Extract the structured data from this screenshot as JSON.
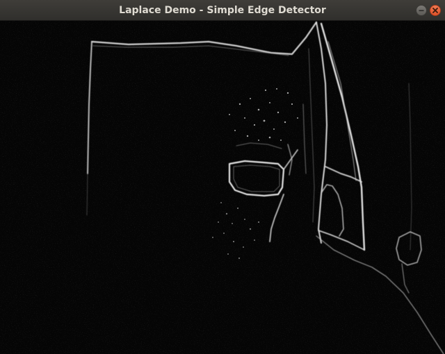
{
  "window": {
    "title": "Laplace Demo - Simple Edge Detector"
  },
  "titlebar_buttons": {
    "minimize_icon": "minimize-icon",
    "close_icon": "close-icon"
  },
  "colors": {
    "titlebar": "#353430",
    "title_text": "#dfdbd2",
    "close_button": "#e95420",
    "canvas_background": "#050505",
    "edge_color": "#ffffff"
  }
}
